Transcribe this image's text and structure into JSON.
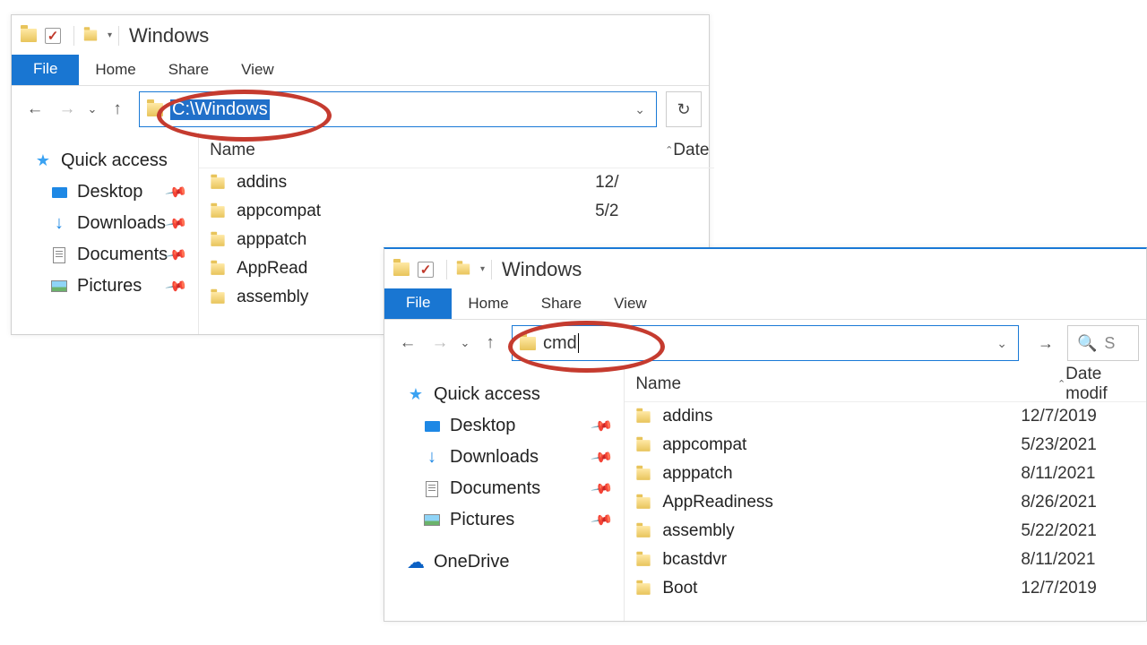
{
  "windowA": {
    "title": "Windows",
    "tabs": {
      "file": "File",
      "home": "Home",
      "share": "Share",
      "view": "View"
    },
    "address_value": "C:\\Windows",
    "columns": {
      "name": "Name",
      "date": "Date"
    },
    "sidebar": {
      "quick": "Quick access",
      "desktop": "Desktop",
      "downloads": "Downloads",
      "documents": "Documents",
      "pictures": "Pictures"
    },
    "rows": [
      {
        "name": "addins",
        "date": "12/"
      },
      {
        "name": "appcompat",
        "date": "5/2"
      },
      {
        "name": "apppatch",
        "date": ""
      },
      {
        "name": "AppRead",
        "date": ""
      },
      {
        "name": "assembly",
        "date": ""
      }
    ]
  },
  "windowB": {
    "title": "Windows",
    "tabs": {
      "file": "File",
      "home": "Home",
      "share": "Share",
      "view": "View"
    },
    "address_value": "cmd",
    "search_hint": "S",
    "columns": {
      "name": "Name",
      "date": "Date modif"
    },
    "sidebar": {
      "quick": "Quick access",
      "desktop": "Desktop",
      "downloads": "Downloads",
      "documents": "Documents",
      "pictures": "Pictures",
      "onedrive": "OneDrive"
    },
    "rows": [
      {
        "name": "addins",
        "date": "12/7/2019"
      },
      {
        "name": "appcompat",
        "date": "5/23/2021"
      },
      {
        "name": "apppatch",
        "date": "8/11/2021"
      },
      {
        "name": "AppReadiness",
        "date": "8/26/2021"
      },
      {
        "name": "assembly",
        "date": "5/22/2021"
      },
      {
        "name": "bcastdvr",
        "date": "8/11/2021"
      },
      {
        "name": "Boot",
        "date": "12/7/2019"
      }
    ]
  }
}
